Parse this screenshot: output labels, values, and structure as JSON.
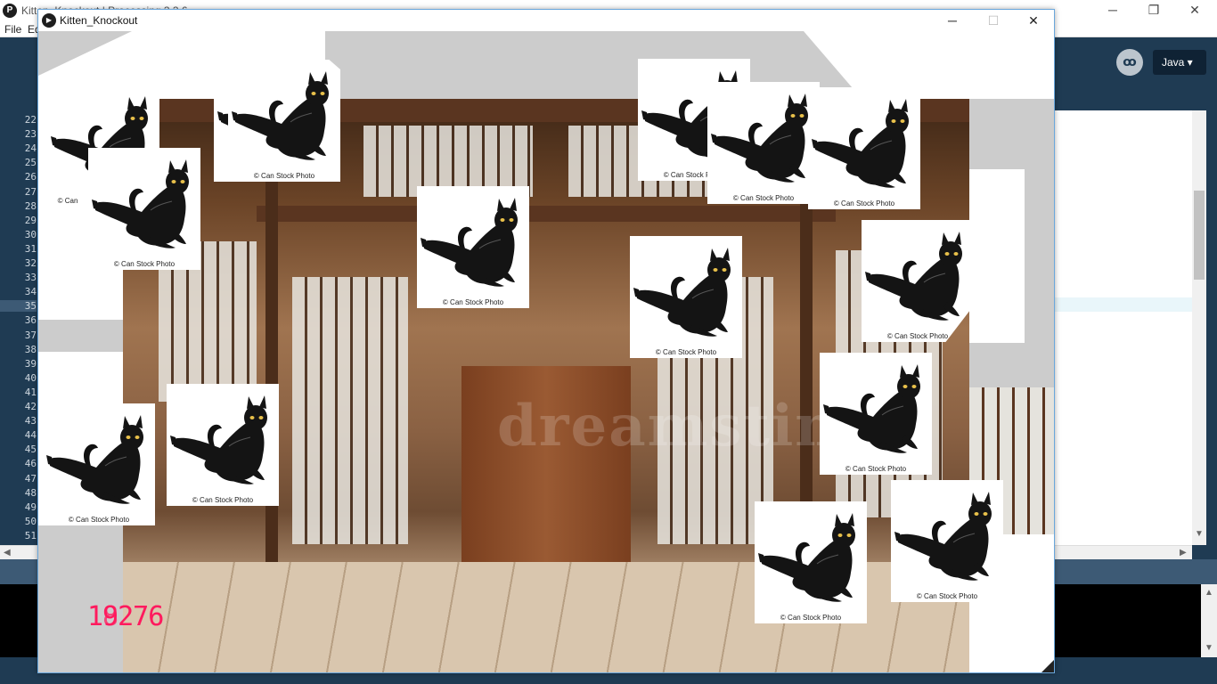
{
  "ide": {
    "title": "Kitten_Knockout | Processing 3.3.6",
    "logo_glyph": "P",
    "menu": [
      "File",
      "Edit"
    ],
    "mode_icon": "processing-mode-icon",
    "mode_label": "Java ▾",
    "line_numbers": [
      "22",
      "23",
      "24",
      "25",
      "26",
      "27",
      "28",
      "29",
      "30",
      "31",
      "32",
      "33",
      "34",
      "35",
      "36",
      "37",
      "38",
      "39",
      "40",
      "41",
      "42",
      "43",
      "44",
      "45",
      "46",
      "47",
      "48",
      "49",
      "50",
      "51"
    ],
    "active_line": "35",
    "controls": {
      "minimize": "─",
      "restore": "❐",
      "close": "✕"
    }
  },
  "sketch": {
    "title": "Kitten_Knockout",
    "icon_glyph": "▶",
    "controls": {
      "minimize": "─",
      "maximize": "☐",
      "close": "✕"
    },
    "watermark": "dreamstime",
    "score_text": "19276",
    "score_overlap": "18276",
    "score_color": "#ff1a5e",
    "cat_credit": "© Can Stock Photo",
    "cat_credit_cut": "© Can Stock P",
    "cat_credit_short": "© Can"
  },
  "colors": {
    "ide_blue": "#1f3b53",
    "canvas_gray": "#cccccc",
    "window_border": "#6aa7dc"
  }
}
